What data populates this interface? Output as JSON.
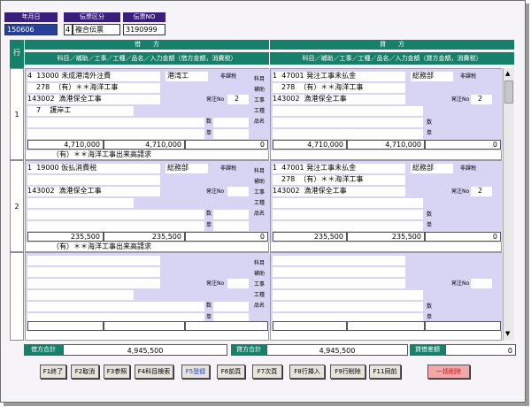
{
  "header": {
    "labels": {
      "date": "年月日",
      "type": "伝票区分",
      "no": "伝票NO"
    },
    "date_value": "150606",
    "type_code": "4",
    "type_value": "複合伝票",
    "no_value": "3190999"
  },
  "grid": {
    "row_label": "行",
    "debit_title": "借　　方",
    "credit_title": "貸　　方",
    "debit_sub": "科目／補助／工事／工種／品名／入力金額（借方金額，消費税）",
    "credit_sub": "科目／補助／工事／工種／品名／入力金額（貸方金額，消費税）",
    "field_labels": {
      "kamoku": "科目",
      "hojo": "補助",
      "koji": "工事",
      "koshu": "工種",
      "hinmei": "品名",
      "su": "数",
      "tan": "単",
      "hasu": "発注No",
      "hikazei": "非課税"
    }
  },
  "rows": [
    {
      "no": "1",
      "debit": {
        "kamoku_code": "4",
        "kamoku_sub": "13000",
        "kamoku_name": "未成港湾外注費",
        "dept": "港湾工",
        "tax": "非課税",
        "hojo_code": "278",
        "hojo_name": "（有）＊＊海洋工事",
        "koji_code": "143002",
        "koji_name": "漁港保全工事",
        "hasu": "2",
        "koshu_code": "7",
        "koshu_name": "護岸工",
        "amount": "4,710,000",
        "base": "4,710,000",
        "tax_amt": "0"
      },
      "credit": {
        "kamoku_code": "1",
        "kamoku_sub": "47001",
        "kamoku_name": "発注工事未払金",
        "dept": "総務部",
        "tax": "非課税",
        "hojo_code": "278",
        "hojo_name": "（有）＊＊海洋工事",
        "koji_code": "143002",
        "koji_name": "漁港保全工事",
        "hasu": "2",
        "amount": "4,710,000",
        "base": "4,710,000",
        "tax_amt": "0"
      },
      "memo": "（有）＊＊海洋工事出来高請求"
    },
    {
      "no": "2",
      "debit": {
        "kamoku_code": "1",
        "kamoku_sub": "19000",
        "kamoku_name": "仮払消費税",
        "dept": "総務部",
        "tax": "非課税",
        "hojo_code": "",
        "hojo_name": "",
        "koji_code": "143002",
        "koji_name": "漁港保全工事",
        "hasu": "",
        "koshu_code": "",
        "koshu_name": "",
        "amount": "235,500",
        "base": "235,500",
        "tax_amt": "0"
      },
      "credit": {
        "kamoku_code": "1",
        "kamoku_sub": "47001",
        "kamoku_name": "発注工事未払金",
        "dept": "総務部",
        "tax": "非課税",
        "hojo_code": "278",
        "hojo_name": "（有）＊＊海洋工事",
        "koji_code": "143002",
        "koji_name": "漁港保全工事",
        "hasu": "2",
        "amount": "235,500",
        "base": "235,500",
        "tax_amt": "0"
      },
      "memo": "（有）＊＊海洋工事出来高請求"
    },
    {
      "no": ""
    }
  ],
  "totals": {
    "debit_label": "借方合計",
    "debit_value": "4,945,500",
    "credit_label": "貸方合計",
    "credit_value": "4,945,500",
    "diff_label": "貸借差額",
    "diff_value": "0"
  },
  "buttons": [
    "F1終了",
    "F2取消",
    "F3参照",
    "F4科目検索",
    "F5登録",
    "F6前頁",
    "F7次頁",
    "F8行挿入",
    "F9行削除",
    "F11同前",
    "一括削除"
  ],
  "colors": {
    "header_purple": "#3a1e7c",
    "teal": "#17806a",
    "lavender": "#d8d4f4",
    "pink": "#f4c4c4"
  }
}
